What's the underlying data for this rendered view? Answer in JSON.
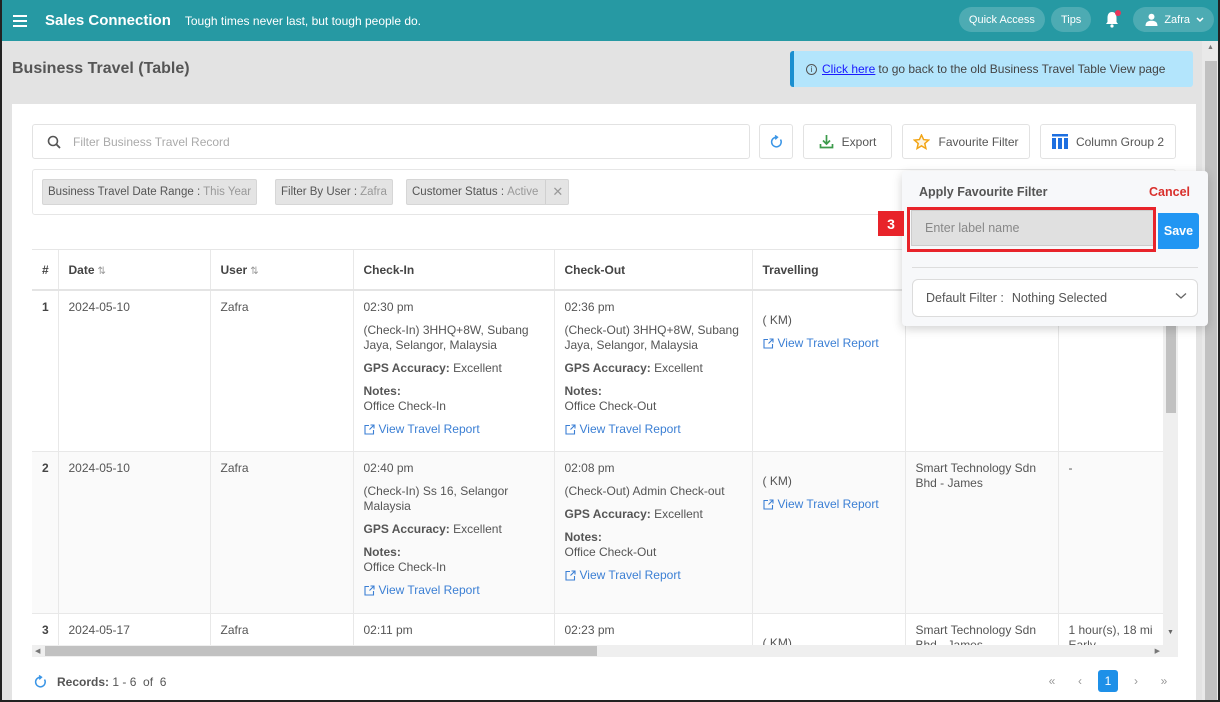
{
  "topbar": {
    "brand": "Sales Connection",
    "tagline": "Tough times never last, but tough people do.",
    "quick_access": "Quick Access",
    "tips": "Tips",
    "user_name": "Zafra",
    "notification_dot_color": "#e8365a",
    "bar_color": "#2699a3"
  },
  "page": {
    "title": "Business Travel (Table)",
    "banner": {
      "link_text": "Click here",
      "text": "to go back to the old Business Travel Table View page"
    }
  },
  "toolbar": {
    "search_placeholder": "Filter Business Travel Record",
    "search_value": "",
    "export_label": "Export",
    "favourite_label": "Favourite Filter",
    "column_group_label": "Column Group 2"
  },
  "filters": [
    {
      "key": "Business Travel Date Range",
      "sep": ":",
      "value": "This Year"
    },
    {
      "key": "Filter By User",
      "sep": ":",
      "value": "Zafra"
    },
    {
      "key": "Customer Status",
      "sep": ":",
      "value": "Active"
    }
  ],
  "table": {
    "columns": [
      "#",
      "Date",
      "User",
      "Check-In",
      "Check-Out",
      "Travelling",
      "",
      ""
    ],
    "sort_icon": "⇅",
    "labels": {
      "gps": "GPS Accuracy:",
      "notes": "Notes:",
      "view_report": "View Travel Report",
      "km": "( KM)"
    },
    "rows": [
      {
        "num": "1",
        "date": "2024-05-10",
        "user": "Zafra",
        "checkin_time": "02:30 pm",
        "checkin_loc": "(Check-In) 3HHQ+8W, Subang Jaya, Selangor, Malaysia",
        "checkin_gps": "Excellent",
        "checkin_notes": "Office Check-In",
        "checkout_time": "02:36 pm",
        "checkout_loc": "(Check-Out) 3HHQ+8W, Subang Jaya, Selangor, Malaysia",
        "checkout_gps": "Excellent",
        "checkout_notes": "Office Check-Out",
        "customer": "",
        "duration": ""
      },
      {
        "num": "2",
        "date": "2024-05-10",
        "user": "Zafra",
        "checkin_time": "02:40 pm",
        "checkin_loc": "(Check-In) Ss 16, Selangor Malaysia",
        "checkin_gps": "Excellent",
        "checkin_notes": "Office Check-In",
        "checkout_time": "02:08 pm",
        "checkout_loc": "(Check-Out) Admin Check-out",
        "checkout_gps": "Excellent",
        "checkout_notes": "Office Check-Out",
        "customer": "Smart Technology Sdn Bhd - James",
        "duration": "-"
      },
      {
        "num": "3",
        "date": "2024-05-17",
        "user": "Zafra",
        "checkin_time": "02:11 pm",
        "checkout_time": "02:23 pm",
        "customer": "Smart Technology Sdn Bhd - James",
        "duration": "1 hour(s), 18 mi",
        "duration_2": "Early"
      }
    ]
  },
  "footer": {
    "records_label": "Records:",
    "records_value": "1 - 6  of  6",
    "pagination": {
      "first": "«",
      "prev": "‹",
      "current": "1",
      "next": "›",
      "last": "»"
    }
  },
  "favourite_popup": {
    "title": "Apply Favourite Filter",
    "cancel": "Cancel",
    "label_placeholder": "Enter label name",
    "label_value": "",
    "save": "Save",
    "default_filter_label": "Default Filter :",
    "default_filter_value": "Nothing Selected",
    "step_badge": "3"
  }
}
